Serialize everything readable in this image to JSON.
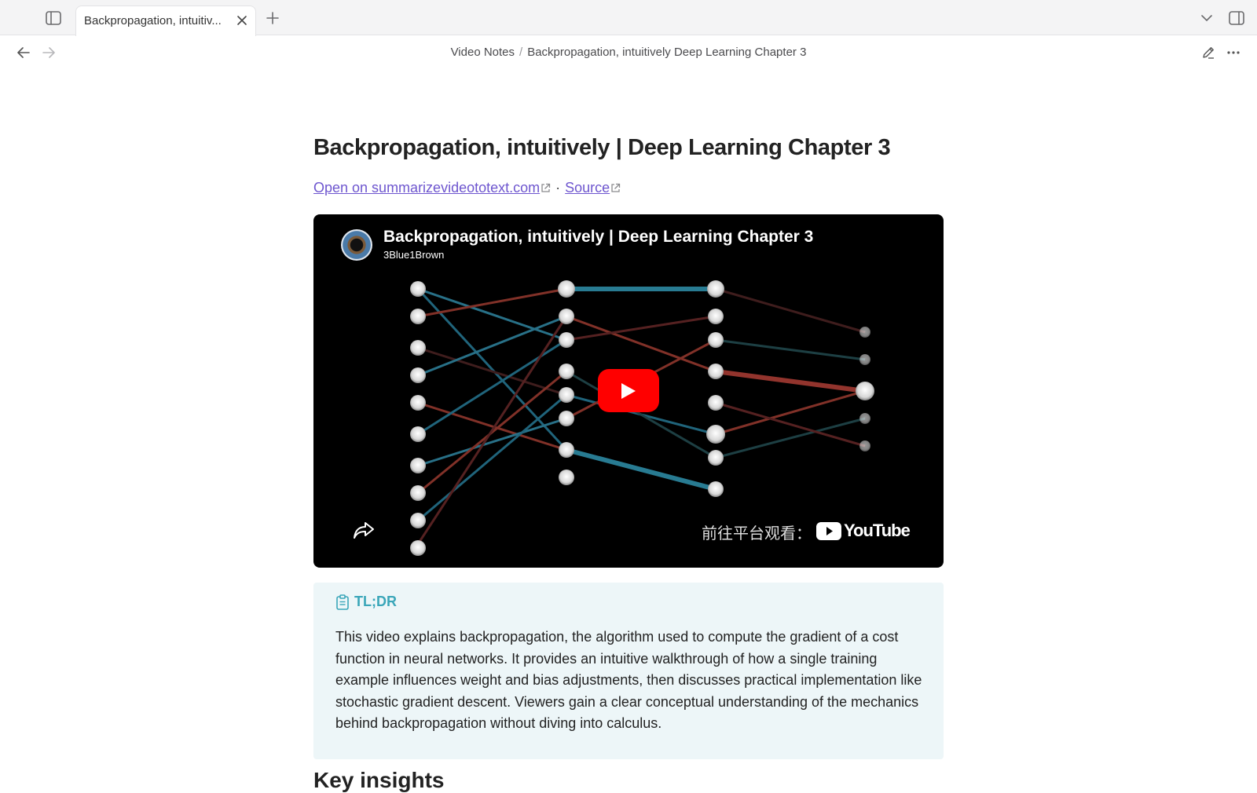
{
  "tabbar": {
    "active_tab_title": "Backpropagation, intuitiv...",
    "icons": [
      "sidebar-toggle-icon",
      "close-icon",
      "plus-icon",
      "chevron-down-icon",
      "right-sidebar-icon"
    ]
  },
  "navbar": {
    "breadcrumb": {
      "folder": "Video Notes",
      "separator": "/",
      "page": "Backpropagation, intuitively Deep Learning Chapter 3"
    }
  },
  "note": {
    "title": "Backpropagation, intuitively | Deep Learning Chapter 3",
    "links": {
      "summary_link": "Open on summarizevideototext.com",
      "separator": "·",
      "source_link": "Source"
    },
    "video": {
      "title": "Backpropagation, intuitively | Deep Learning Chapter 3",
      "channel": "3Blue1Brown",
      "watch_on": "前往平台观看：",
      "platform": "YouTube"
    },
    "tldr": {
      "label": "TL;DR",
      "text": "This video explains backpropagation, the algorithm used to compute the gradient of a cost function in neural networks. It provides an intuitive walkthrough of how a single training example influences weight and bias adjustments, then discusses practical implementation like stochastic gradient descent. Viewers gain a clear conceptual understanding of the mechanics behind backpropagation without diving into calculus."
    },
    "next_heading": "Key insights"
  },
  "colors": {
    "link": "#6e56cf",
    "callout_bg": "#edf6f8",
    "callout_accent": "#3aa6b9",
    "youtube_red": "#ff0000"
  }
}
